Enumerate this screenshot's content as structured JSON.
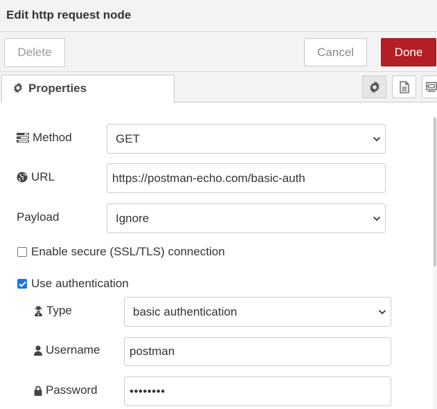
{
  "dialog": {
    "title": "Edit http request node"
  },
  "toolbar": {
    "delete_label": "Delete",
    "cancel_label": "Cancel",
    "done_label": "Done"
  },
  "tabs": {
    "properties_label": "Properties"
  },
  "form": {
    "method": {
      "label": "Method",
      "value": "GET"
    },
    "url": {
      "label": "URL",
      "value": "https://postman-echo.com/basic-auth"
    },
    "payload": {
      "label": "Payload",
      "value": "Ignore"
    },
    "ssl": {
      "label": "Enable secure (SSL/TLS) connection",
      "checked": false
    },
    "auth": {
      "label": "Use authentication",
      "checked": true
    },
    "auth_type": {
      "label": "Type",
      "value": "basic authentication"
    },
    "username": {
      "label": "Username",
      "value": "postman"
    },
    "password": {
      "label": "Password",
      "value": "••••••••"
    }
  },
  "colors": {
    "accent": "#b31f24",
    "checkbox": "#1a73e8"
  }
}
